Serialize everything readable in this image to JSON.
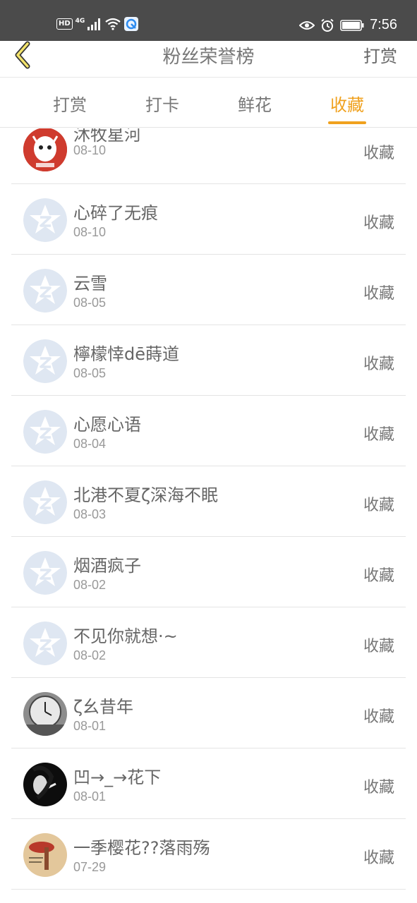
{
  "status_bar": {
    "hd": "HD",
    "network": "4G",
    "time": "7:56"
  },
  "header": {
    "title": "粉丝荣誉榜",
    "action": "打赏"
  },
  "tabs": [
    {
      "label": "打赏",
      "active": false
    },
    {
      "label": "打卡",
      "active": false
    },
    {
      "label": "鲜花",
      "active": false
    },
    {
      "label": "收藏",
      "active": true
    }
  ],
  "rows": [
    {
      "name": "沐牧星河",
      "date": "08-10",
      "action": "收藏",
      "avatar": "cartoon-avatar"
    },
    {
      "name": "心碎了无痕",
      "date": "08-10",
      "action": "收藏",
      "avatar": "default-qq-avatar"
    },
    {
      "name": "云雪",
      "date": "08-05",
      "action": "收藏",
      "avatar": "default-qq-avatar"
    },
    {
      "name": "檸檬悻dē蒔道",
      "date": "08-05",
      "action": "收藏",
      "avatar": "default-qq-avatar"
    },
    {
      "name": "心愿心语",
      "date": "08-04",
      "action": "收藏",
      "avatar": "default-qq-avatar"
    },
    {
      "name": "北港不夏ζ深海不眠",
      "date": "08-03",
      "action": "收藏",
      "avatar": "default-qq-avatar"
    },
    {
      "name": "烟酒疯子",
      "date": "08-02",
      "action": "收藏",
      "avatar": "default-qq-avatar"
    },
    {
      "name": "不见你就想·~",
      "date": "08-02",
      "action": "收藏",
      "avatar": "default-qq-avatar"
    },
    {
      "name": "ζ⺓昔年",
      "date": "08-01",
      "action": "收藏",
      "avatar": "clock-photo-avatar"
    },
    {
      "name": "凹→_→花下",
      "date": "08-01",
      "action": "收藏",
      "avatar": "dark-photo-avatar"
    },
    {
      "name": "一季樱花??落雨殇",
      "date": "07-29",
      "action": "收藏",
      "avatar": "beige-illustration-avatar"
    }
  ],
  "colors": {
    "accent": "#f0a11e",
    "status_bar": "#4b4b4b",
    "default_avatar": "#dfe7f2"
  }
}
